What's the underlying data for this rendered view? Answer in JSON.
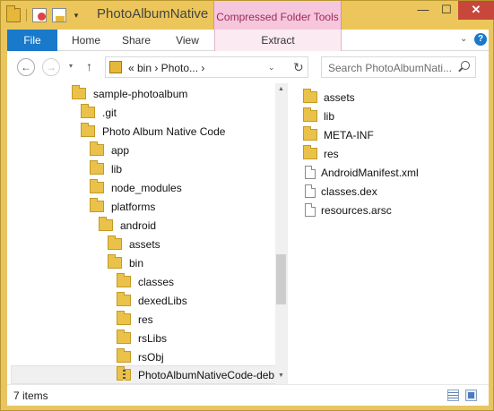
{
  "window": {
    "title": "PhotoAlbumNative",
    "context_tab_header": "Compressed Folder Tools",
    "minimize_glyph": "—",
    "maximize_glyph": "☐",
    "close_glyph": "✕"
  },
  "ribbon": {
    "tabs": [
      "File",
      "Home",
      "Share",
      "View",
      "Extract"
    ],
    "collapse_glyph": "⌄",
    "help_glyph": "?"
  },
  "address": {
    "back_glyph": "←",
    "forward_glyph": "→",
    "recent_glyph": "▾",
    "up_glyph": "↑",
    "path_text": "«  bin  ›  Photo...  ›",
    "dropdown_glyph": "⌄",
    "refresh_glyph": "↻"
  },
  "search": {
    "placeholder": "Search PhotoAlbumNati..."
  },
  "tree": {
    "items": [
      {
        "label": "sample-photoalbum"
      },
      {
        "label": ".git"
      },
      {
        "label": "Photo Album Native Code"
      },
      {
        "label": "app"
      },
      {
        "label": "lib"
      },
      {
        "label": "node_modules"
      },
      {
        "label": "platforms"
      },
      {
        "label": "android"
      },
      {
        "label": "assets"
      },
      {
        "label": "bin"
      },
      {
        "label": "classes"
      },
      {
        "label": "dexedLibs"
      },
      {
        "label": "res"
      },
      {
        "label": "rsLibs"
      },
      {
        "label": "rsObj"
      },
      {
        "label": "PhotoAlbumNativeCode-deb"
      }
    ]
  },
  "scroll": {
    "up_glyph": "▲",
    "down_glyph": "▼"
  },
  "files": {
    "items": [
      {
        "label": "assets",
        "kind": "folder"
      },
      {
        "label": "lib",
        "kind": "folder"
      },
      {
        "label": "META-INF",
        "kind": "folder"
      },
      {
        "label": "res",
        "kind": "folder"
      },
      {
        "label": "AndroidManifest.xml",
        "kind": "file"
      },
      {
        "label": "classes.dex",
        "kind": "file"
      },
      {
        "label": "resources.arsc",
        "kind": "file"
      }
    ]
  },
  "status": {
    "item_count": "7 items"
  }
}
